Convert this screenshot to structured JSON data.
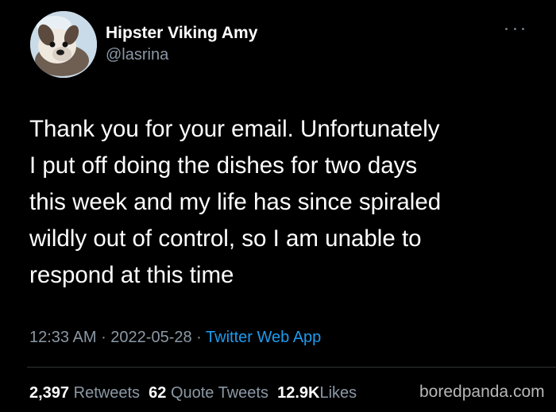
{
  "author": {
    "display_name": "Hipster Viking Amy",
    "handle": "@lasrina",
    "avatar_icon": "dog-avatar-icon"
  },
  "more_icon": "more-options-icon",
  "tweet": {
    "lines": [
      "Thank you for your email. Unfortunately",
      "I put off doing the dishes for two days",
      "this week and my life has since spiraled",
      "wildly out of control, so I am unable to",
      "respond at this time"
    ]
  },
  "meta": {
    "time": "12:33 AM",
    "separator": " · ",
    "date": "2022-05-28",
    "source": "Twitter Web App"
  },
  "stats": {
    "retweets_count": "2,397",
    "retweets_label": "Retweets",
    "quote_count": "62",
    "quote_label": "Quote Tweets",
    "likes_count": "12.9K",
    "likes_label": "Likes"
  },
  "watermark": "boredpanda.com",
  "colors": {
    "background": "#000000",
    "primary_text": "#ffffff",
    "secondary_text": "#8b98a5",
    "link": "#1d9bf0",
    "divider": "#2f3336"
  }
}
